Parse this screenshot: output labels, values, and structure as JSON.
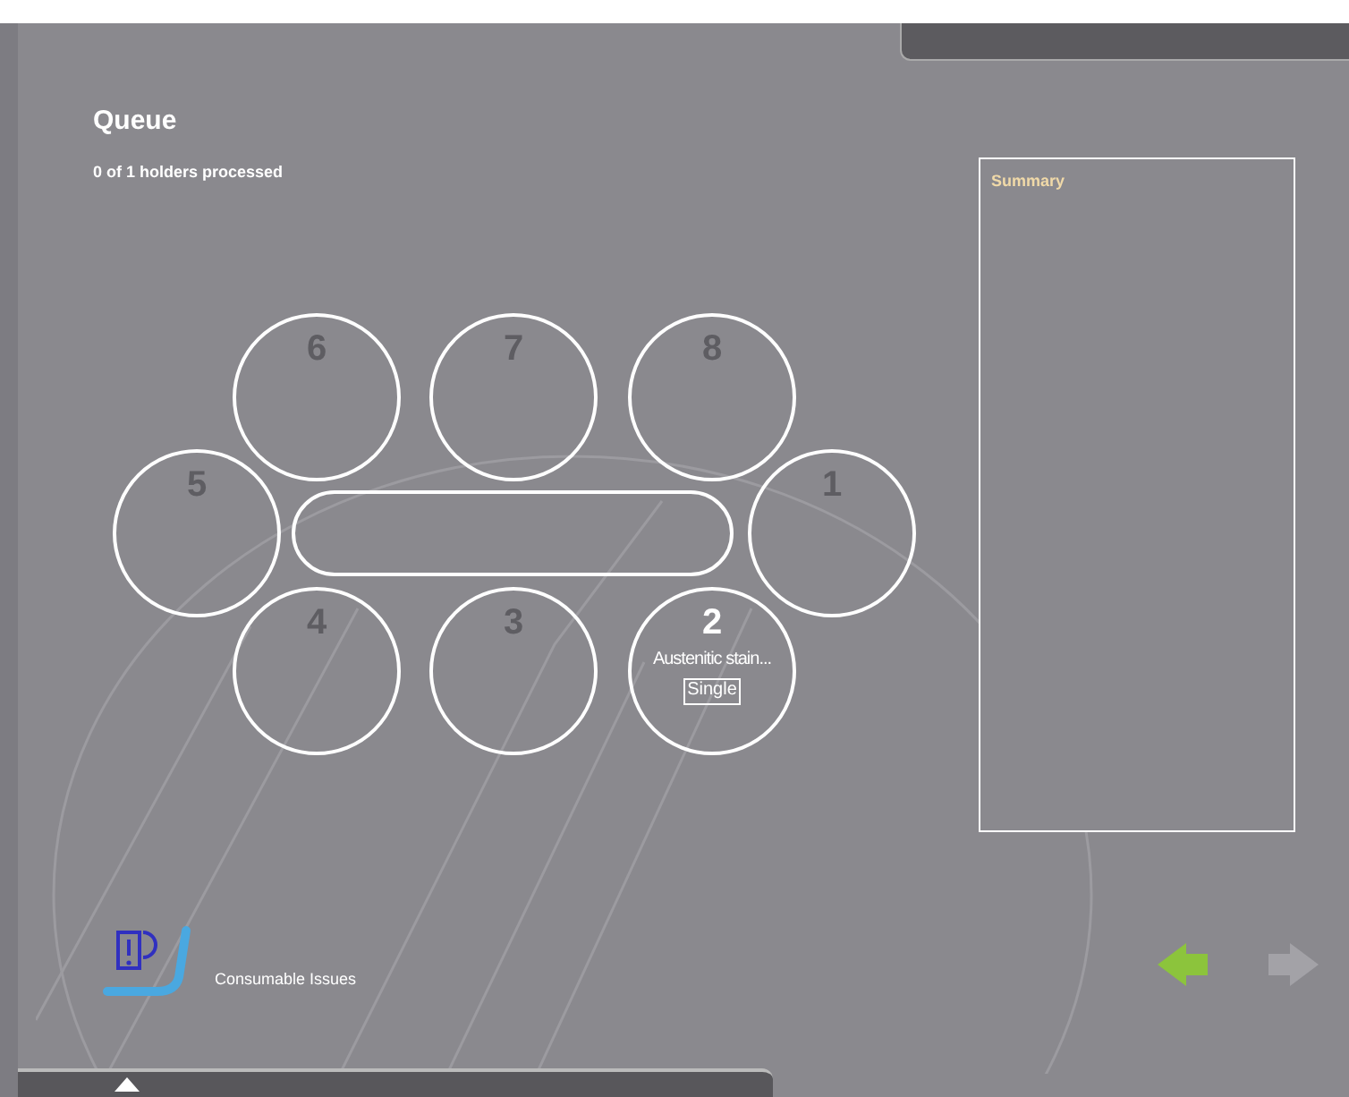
{
  "title": "Queue",
  "progress": "0 of 1 holders processed",
  "slots": [
    {
      "number": "6",
      "occupied": false
    },
    {
      "number": "7",
      "occupied": false
    },
    {
      "number": "8",
      "occupied": false
    },
    {
      "number": "5",
      "occupied": false
    },
    {
      "number": "1",
      "occupied": false
    },
    {
      "number": "4",
      "occupied": false
    },
    {
      "number": "3",
      "occupied": false
    },
    {
      "number": "2",
      "occupied": true,
      "label": "Austenitic stain...",
      "mode": "Single"
    }
  ],
  "summary": {
    "title": "Summary"
  },
  "consumables": {
    "label": "Consumable Issues"
  },
  "navigation": {
    "back": {
      "disabled": false
    },
    "forward": {
      "disabled": true
    }
  }
}
